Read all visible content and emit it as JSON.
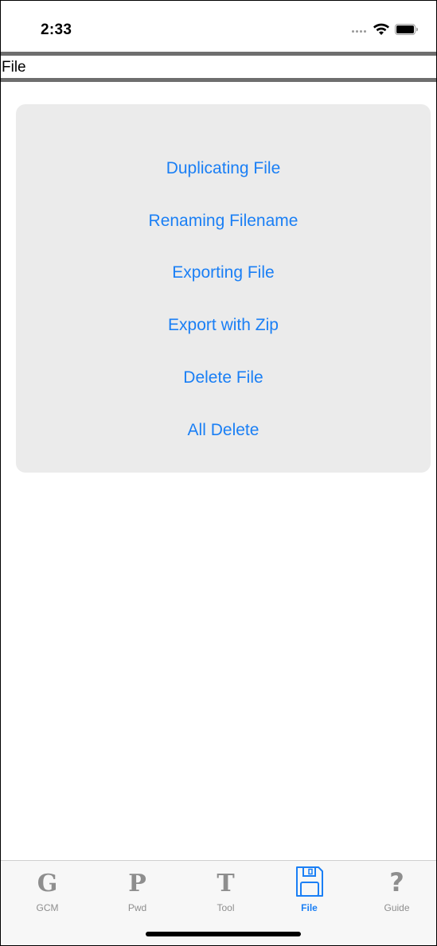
{
  "status_bar": {
    "time": "2:33",
    "icons": [
      "signal-dots-icon",
      "wifi-icon",
      "battery-icon"
    ]
  },
  "nav": {
    "title": "File"
  },
  "actions": [
    {
      "label": "Duplicating File"
    },
    {
      "label": "Renaming Filename"
    },
    {
      "label": "Exporting File"
    },
    {
      "label": "Export with Zip"
    },
    {
      "label": "Delete File"
    },
    {
      "label": "All Delete"
    }
  ],
  "tabs": [
    {
      "label": "GCM",
      "glyph": "G",
      "icon": "letter-g-icon",
      "active": false
    },
    {
      "label": "Pwd",
      "glyph": "P",
      "icon": "letter-p-icon",
      "active": false
    },
    {
      "label": "Tool",
      "glyph": "T",
      "icon": "letter-t-icon",
      "active": false
    },
    {
      "label": "File",
      "glyph": "",
      "icon": "floppy-disk-icon",
      "active": true
    },
    {
      "label": "Guide",
      "glyph": "?",
      "icon": "question-mark-icon",
      "active": false
    }
  ],
  "colors": {
    "accent": "#1a7ff5",
    "inactive": "#8e8e8e",
    "card_background": "#ebebeb",
    "nav_line": "#6e6e6e"
  }
}
